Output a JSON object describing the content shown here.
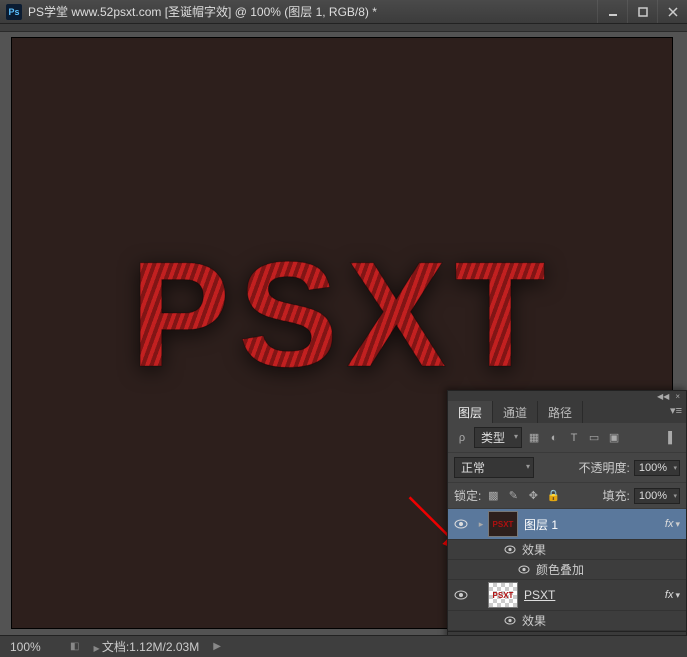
{
  "window": {
    "app_logo_text": "Ps",
    "title": "PS学堂 www.52psxt.com [圣诞帽字效] @ 100% (图层 1, RGB/8) *"
  },
  "canvas": {
    "main_text": "PSXT",
    "bg_color": "#2d1f1c"
  },
  "panel": {
    "tabs": {
      "layers": "图层",
      "channels": "通道",
      "paths": "路径"
    },
    "filter_label": "类型",
    "blend_mode": "正常",
    "opacity_label": "不透明度:",
    "opacity_value": "100%",
    "lock_label": "锁定:",
    "fill_label": "填充:",
    "fill_value": "100%",
    "icons": {
      "search": "search-icon",
      "image_filter": "image-filter-icon",
      "adj_filter": "adjustment-filter-icon",
      "type_filter": "type-filter-icon",
      "shape_filter": "shape-filter-icon",
      "smart_filter": "smart-filter-icon"
    },
    "layers": [
      {
        "name": "图层 1",
        "selected": true,
        "has_fx": true,
        "effects": {
          "header": "效果",
          "items": [
            "颜色叠加"
          ]
        }
      },
      {
        "name": "PSXT",
        "selected": false,
        "has_fx": true,
        "transparent": true,
        "effects": {
          "header": "效果",
          "items": []
        }
      }
    ],
    "fx_label": "fx"
  },
  "statusbar": {
    "zoom": "100%",
    "docinfo": "文档:1.12M/2.03M"
  }
}
